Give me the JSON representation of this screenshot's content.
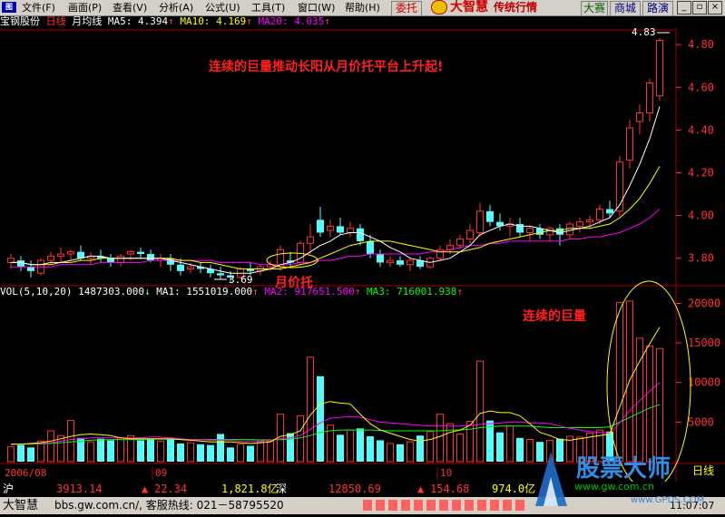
{
  "menubar": {
    "app_icon": "图",
    "items": [
      "文件(F)",
      "画面(P)",
      "查看(V)",
      "分析(A)",
      "公式(U)",
      "工具(T)",
      "窗口(W)",
      "帮助(H)"
    ],
    "weituo_label": "委托",
    "brand_name": "大智慧",
    "brand_sub": "传统行情",
    "tabs": [
      "大赛",
      "商城",
      "路演"
    ],
    "win_min": "_",
    "win_restore": "▫",
    "win_close": "×"
  },
  "colors": {
    "up": "#ff3232",
    "down": "#54fcfc",
    "ma5": "#ffffff",
    "ma10": "#ffff00",
    "ma20": "#ff00ff",
    "vol_ma3": "#00ff00",
    "annotation": "#ff2020"
  },
  "price_info": {
    "stock": "宝钢股份",
    "period": "日线",
    "indicator": "月均线",
    "ma5_label": "MA5: 4.394",
    "ma10_label": "MA10: 4.169",
    "ma20_label": "MA20: 4.035",
    "arrow": "↑"
  },
  "vol_info": {
    "label": "VOL(5,10,20) 1487303.000",
    "down_arrow": "↓",
    "ma1_label": "MA1: 1551019.000",
    "ma2_label": "MA2: 917651.500",
    "ma3_label": "MA3: 716001.938",
    "arrow": "↑"
  },
  "annotations": {
    "main_text": "连续的巨量推动长阳从月价托平台上升起!",
    "platform_text": "月价托",
    "volume_text": "连续的巨量",
    "high_label": "4.83",
    "low_label": "3.69"
  },
  "date_labels": {
    "d1": "2006/08",
    "d2": "09",
    "d3": "10"
  },
  "status": {
    "market1": "沪",
    "index1": "3913.14",
    "arrow1": "▲",
    "change1": "22.34",
    "amount1": "1,821.8亿",
    "market2": "深",
    "index2": "12850.69",
    "arrow2": "▲",
    "change2": "154.68",
    "amount2": "974.0亿",
    "app": "大智慧",
    "website": "bbs.gw.com.cn/, 客服热线: 021－58795520",
    "time": "11:07:07"
  },
  "watermark": {
    "brand": "股票大师",
    "url": "www.gw.com.cn",
    "url2": "www.GPDS.COM",
    "tag": "日线"
  },
  "chart_data": {
    "type": "candlestick",
    "price_axis": {
      "ticks": [
        3.8,
        4.0,
        4.2,
        4.4,
        4.6,
        4.8
      ],
      "range": [
        3.68,
        4.86
      ]
    },
    "volume_axis": {
      "ticks": [
        5000,
        10000,
        15000,
        20000
      ],
      "range": [
        0,
        22000
      ]
    },
    "candles": [
      {
        "o": 3.78,
        "h": 3.82,
        "l": 3.75,
        "c": 3.8,
        "v": 1900,
        "up": true
      },
      {
        "o": 3.79,
        "h": 3.81,
        "l": 3.74,
        "c": 3.76,
        "v": 2100,
        "up": false
      },
      {
        "o": 3.76,
        "h": 3.79,
        "l": 3.71,
        "c": 3.74,
        "v": 1800,
        "up": false
      },
      {
        "o": 3.73,
        "h": 3.8,
        "l": 3.72,
        "c": 3.79,
        "v": 2600,
        "up": true
      },
      {
        "o": 3.79,
        "h": 3.83,
        "l": 3.77,
        "c": 3.81,
        "v": 3900,
        "up": true
      },
      {
        "o": 3.81,
        "h": 3.85,
        "l": 3.78,
        "c": 3.82,
        "v": 3300,
        "up": true
      },
      {
        "o": 3.82,
        "h": 3.84,
        "l": 3.79,
        "c": 3.83,
        "v": 5200,
        "up": true
      },
      {
        "o": 3.83,
        "h": 3.86,
        "l": 3.79,
        "c": 3.8,
        "v": 3000,
        "up": false
      },
      {
        "o": 3.8,
        "h": 3.83,
        "l": 3.77,
        "c": 3.81,
        "v": 2500,
        "up": true
      },
      {
        "o": 3.81,
        "h": 3.84,
        "l": 3.78,
        "c": 3.8,
        "v": 2900,
        "up": false
      },
      {
        "o": 3.8,
        "h": 3.82,
        "l": 3.76,
        "c": 3.78,
        "v": 2700,
        "up": false
      },
      {
        "o": 3.78,
        "h": 3.82,
        "l": 3.76,
        "c": 3.81,
        "v": 3000,
        "up": true
      },
      {
        "o": 3.82,
        "h": 3.84,
        "l": 3.79,
        "c": 3.83,
        "v": 3300,
        "up": true
      },
      {
        "o": 3.83,
        "h": 3.85,
        "l": 3.8,
        "c": 3.82,
        "v": 2700,
        "up": false
      },
      {
        "o": 3.82,
        "h": 3.84,
        "l": 3.78,
        "c": 3.79,
        "v": 2900,
        "up": false
      },
      {
        "o": 3.79,
        "h": 3.82,
        "l": 3.76,
        "c": 3.8,
        "v": 2600,
        "up": true
      },
      {
        "o": 3.8,
        "h": 3.82,
        "l": 3.74,
        "c": 3.77,
        "v": 2800,
        "up": false
      },
      {
        "o": 3.77,
        "h": 3.8,
        "l": 3.72,
        "c": 3.74,
        "v": 2300,
        "up": false
      },
      {
        "o": 3.75,
        "h": 3.78,
        "l": 3.73,
        "c": 3.76,
        "v": 2400,
        "up": true
      },
      {
        "o": 3.76,
        "h": 3.78,
        "l": 3.73,
        "c": 3.75,
        "v": 2200,
        "up": false
      },
      {
        "o": 3.75,
        "h": 3.77,
        "l": 3.71,
        "c": 3.73,
        "v": 2100,
        "up": false
      },
      {
        "o": 3.73,
        "h": 3.76,
        "l": 3.7,
        "c": 3.72,
        "v": 3500,
        "up": false
      },
      {
        "o": 3.72,
        "h": 3.74,
        "l": 3.69,
        "c": 3.71,
        "v": 1800,
        "up": false
      },
      {
        "o": 3.71,
        "h": 3.76,
        "l": 3.7,
        "c": 3.75,
        "v": 2200,
        "up": true
      },
      {
        "o": 3.75,
        "h": 3.78,
        "l": 3.72,
        "c": 3.74,
        "v": 2000,
        "up": false
      },
      {
        "o": 3.74,
        "h": 3.77,
        "l": 3.72,
        "c": 3.76,
        "v": 2500,
        "up": true
      },
      {
        "o": 3.76,
        "h": 3.79,
        "l": 3.74,
        "c": 3.77,
        "v": 2600,
        "up": true
      },
      {
        "o": 3.76,
        "h": 3.86,
        "l": 3.74,
        "c": 3.84,
        "v": 6000,
        "up": true
      },
      {
        "o": 3.79,
        "h": 3.83,
        "l": 3.76,
        "c": 3.78,
        "v": 3600,
        "up": false
      },
      {
        "o": 3.78,
        "h": 3.88,
        "l": 3.77,
        "c": 3.87,
        "v": 5800,
        "up": true
      },
      {
        "o": 3.87,
        "h": 3.96,
        "l": 3.82,
        "c": 3.9,
        "v": 13200,
        "up": true
      },
      {
        "o": 3.98,
        "h": 4.04,
        "l": 3.9,
        "c": 3.92,
        "v": 10800,
        "up": false
      },
      {
        "o": 3.93,
        "h": 3.98,
        "l": 3.9,
        "c": 3.95,
        "v": 4600,
        "up": true
      },
      {
        "o": 3.95,
        "h": 3.99,
        "l": 3.91,
        "c": 3.92,
        "v": 3400,
        "up": false
      },
      {
        "o": 3.92,
        "h": 3.97,
        "l": 3.9,
        "c": 3.94,
        "v": 4000,
        "up": true
      },
      {
        "o": 3.94,
        "h": 3.96,
        "l": 3.86,
        "c": 3.88,
        "v": 4200,
        "up": false
      },
      {
        "o": 3.88,
        "h": 3.91,
        "l": 3.8,
        "c": 3.82,
        "v": 3200,
        "up": false
      },
      {
        "o": 3.82,
        "h": 3.84,
        "l": 3.76,
        "c": 3.78,
        "v": 2700,
        "up": false
      },
      {
        "o": 3.78,
        "h": 3.81,
        "l": 3.76,
        "c": 3.79,
        "v": 2300,
        "up": true
      },
      {
        "o": 3.79,
        "h": 3.81,
        "l": 3.76,
        "c": 3.77,
        "v": 2200,
        "up": false
      },
      {
        "o": 3.77,
        "h": 3.8,
        "l": 3.74,
        "c": 3.79,
        "v": 2500,
        "up": true
      },
      {
        "o": 3.79,
        "h": 3.81,
        "l": 3.75,
        "c": 3.76,
        "v": 3300,
        "up": false
      },
      {
        "o": 3.76,
        "h": 3.81,
        "l": 3.75,
        "c": 3.8,
        "v": 3800,
        "up": true
      },
      {
        "o": 3.8,
        "h": 3.86,
        "l": 3.79,
        "c": 3.84,
        "v": 6000,
        "up": true
      },
      {
        "o": 3.84,
        "h": 3.89,
        "l": 3.82,
        "c": 3.86,
        "v": 4800,
        "up": true
      },
      {
        "o": 3.86,
        "h": 3.91,
        "l": 3.84,
        "c": 3.89,
        "v": 3500,
        "up": true
      },
      {
        "o": 3.89,
        "h": 3.96,
        "l": 3.87,
        "c": 3.93,
        "v": 5100,
        "up": true
      },
      {
        "o": 3.92,
        "h": 4.06,
        "l": 3.9,
        "c": 4.02,
        "v": 12700,
        "up": true
      },
      {
        "o": 4.02,
        "h": 4.05,
        "l": 3.95,
        "c": 3.97,
        "v": 5200,
        "up": false
      },
      {
        "o": 3.97,
        "h": 4.01,
        "l": 3.93,
        "c": 3.95,
        "v": 3700,
        "up": false
      },
      {
        "o": 3.95,
        "h": 3.99,
        "l": 3.9,
        "c": 3.96,
        "v": 4500,
        "up": true
      },
      {
        "o": 3.96,
        "h": 3.99,
        "l": 3.9,
        "c": 3.92,
        "v": 3000,
        "up": false
      },
      {
        "o": 3.92,
        "h": 3.95,
        "l": 3.88,
        "c": 3.94,
        "v": 2800,
        "up": true
      },
      {
        "o": 3.94,
        "h": 3.96,
        "l": 3.89,
        "c": 3.91,
        "v": 2500,
        "up": false
      },
      {
        "o": 3.91,
        "h": 3.95,
        "l": 3.88,
        "c": 3.94,
        "v": 2700,
        "up": true
      },
      {
        "o": 3.94,
        "h": 3.96,
        "l": 3.86,
        "c": 3.91,
        "v": 2900,
        "up": false
      },
      {
        "o": 3.91,
        "h": 3.97,
        "l": 3.89,
        "c": 3.96,
        "v": 3200,
        "up": true
      },
      {
        "o": 3.95,
        "h": 3.99,
        "l": 3.92,
        "c": 3.97,
        "v": 3100,
        "up": true
      },
      {
        "o": 3.97,
        "h": 4.0,
        "l": 3.94,
        "c": 3.98,
        "v": 3600,
        "up": true
      },
      {
        "o": 3.98,
        "h": 4.05,
        "l": 3.96,
        "c": 4.03,
        "v": 4000,
        "up": true
      },
      {
        "o": 4.03,
        "h": 4.07,
        "l": 3.99,
        "c": 4.01,
        "v": 3800,
        "up": false
      },
      {
        "o": 4.02,
        "h": 4.28,
        "l": 4.0,
        "c": 4.25,
        "v": 20100,
        "up": true
      },
      {
        "o": 4.26,
        "h": 4.45,
        "l": 4.22,
        "c": 4.41,
        "v": 20300,
        "up": true
      },
      {
        "o": 4.44,
        "h": 4.52,
        "l": 4.38,
        "c": 4.48,
        "v": 15600,
        "up": true
      },
      {
        "o": 4.48,
        "h": 4.64,
        "l": 4.44,
        "c": 4.62,
        "v": 14600,
        "up": true
      },
      {
        "o": 4.56,
        "h": 4.83,
        "l": 4.54,
        "c": 4.82,
        "v": 14300,
        "up": true
      }
    ],
    "ma5": [
      3.78,
      3.78,
      3.77,
      3.77,
      3.78,
      3.78,
      3.79,
      3.8,
      3.81,
      3.81,
      3.8,
      3.8,
      3.8,
      3.8,
      3.8,
      3.8,
      3.79,
      3.78,
      3.77,
      3.76,
      3.75,
      3.74,
      3.73,
      3.73,
      3.73,
      3.74,
      3.75,
      3.77,
      3.78,
      3.8,
      3.83,
      3.86,
      3.88,
      3.91,
      3.92,
      3.92,
      3.9,
      3.88,
      3.85,
      3.83,
      3.8,
      3.79,
      3.78,
      3.79,
      3.8,
      3.83,
      3.86,
      3.91,
      3.93,
      3.95,
      3.96,
      3.95,
      3.95,
      3.94,
      3.93,
      3.92,
      3.93,
      3.94,
      3.95,
      3.97,
      3.99,
      4.05,
      4.14,
      4.24,
      4.36,
      4.51
    ],
    "ma10": [
      3.78,
      3.78,
      3.77,
      3.77,
      3.77,
      3.78,
      3.78,
      3.79,
      3.79,
      3.8,
      3.8,
      3.8,
      3.8,
      3.8,
      3.8,
      3.8,
      3.8,
      3.79,
      3.79,
      3.78,
      3.78,
      3.77,
      3.76,
      3.75,
      3.75,
      3.75,
      3.75,
      3.75,
      3.76,
      3.77,
      3.78,
      3.8,
      3.82,
      3.84,
      3.86,
      3.87,
      3.88,
      3.88,
      3.88,
      3.87,
      3.86,
      3.85,
      3.84,
      3.83,
      3.83,
      3.83,
      3.84,
      3.85,
      3.87,
      3.88,
      3.89,
      3.9,
      3.91,
      3.92,
      3.93,
      3.93,
      3.94,
      3.94,
      3.94,
      3.95,
      3.96,
      3.99,
      4.03,
      4.08,
      4.15,
      4.23
    ],
    "ma20": [
      3.76,
      3.76,
      3.76,
      3.76,
      3.76,
      3.77,
      3.77,
      3.77,
      3.77,
      3.78,
      3.78,
      3.78,
      3.78,
      3.78,
      3.79,
      3.79,
      3.79,
      3.79,
      3.79,
      3.79,
      3.79,
      3.78,
      3.78,
      3.78,
      3.78,
      3.77,
      3.77,
      3.77,
      3.77,
      3.78,
      3.78,
      3.79,
      3.79,
      3.8,
      3.81,
      3.81,
      3.82,
      3.82,
      3.82,
      3.82,
      3.82,
      3.82,
      3.83,
      3.83,
      3.84,
      3.85,
      3.86,
      3.86,
      3.87,
      3.87,
      3.88,
      3.88,
      3.88,
      3.88,
      3.88,
      3.88,
      3.89,
      3.89,
      3.9,
      3.9,
      3.91,
      3.92,
      3.94,
      3.96,
      3.99,
      4.03
    ],
    "vol_ma1": [
      2200,
      2200,
      2300,
      2400,
      2600,
      2900,
      3200,
      3400,
      3500,
      3400,
      3300,
      3000,
      2900,
      2900,
      2900,
      2900,
      2900,
      2800,
      2700,
      2600,
      2500,
      2500,
      2500,
      2400,
      2300,
      2400,
      2500,
      3200,
      3400,
      3900,
      5900,
      7300,
      7600,
      7400,
      7300,
      6000,
      4800,
      4000,
      3600,
      3200,
      2800,
      2600,
      2800,
      3200,
      3700,
      4000,
      4600,
      6100,
      6400,
      6200,
      6200,
      5800,
      4800,
      3700,
      3300,
      2800,
      2700,
      2900,
      3100,
      3300,
      3500,
      6900,
      10300,
      12700,
      14900,
      17000
    ],
    "vol_ma2": [
      2200,
      2200,
      2250,
      2300,
      2400,
      2600,
      2800,
      2900,
      3000,
      3000,
      3000,
      3000,
      3000,
      3000,
      3100,
      3100,
      3000,
      2900,
      2800,
      2800,
      2700,
      2700,
      2700,
      2600,
      2600,
      2600,
      2700,
      2900,
      3000,
      3300,
      4100,
      4900,
      5500,
      5600,
      5700,
      5600,
      5300,
      5000,
      4900,
      4800,
      4700,
      4600,
      4500,
      4500,
      4500,
      4500,
      4600,
      4700,
      4800,
      4900,
      5000,
      5000,
      4900,
      4900,
      4800,
      4500,
      4200,
      4000,
      3800,
      3700,
      3600,
      4900,
      6500,
      7700,
      8900,
      10000
    ],
    "vol_ma3": [
      2200,
      2200,
      2200,
      2250,
      2300,
      2400,
      2500,
      2600,
      2700,
      2750,
      2800,
      2800,
      2800,
      2800,
      2850,
      2850,
      2850,
      2850,
      2800,
      2800,
      2800,
      2800,
      2800,
      2800,
      2800,
      2750,
      2750,
      2800,
      2850,
      3000,
      3300,
      3700,
      3900,
      4000,
      4000,
      4000,
      4000,
      3950,
      3900,
      3900,
      3900,
      3900,
      3900,
      3900,
      4000,
      4000,
      4100,
      4300,
      4400,
      4500,
      4500,
      4500,
      4500,
      4400,
      4300,
      4300,
      4300,
      4300,
      4300,
      4300,
      4400,
      5000,
      5600,
      6200,
      6800,
      7200
    ]
  }
}
